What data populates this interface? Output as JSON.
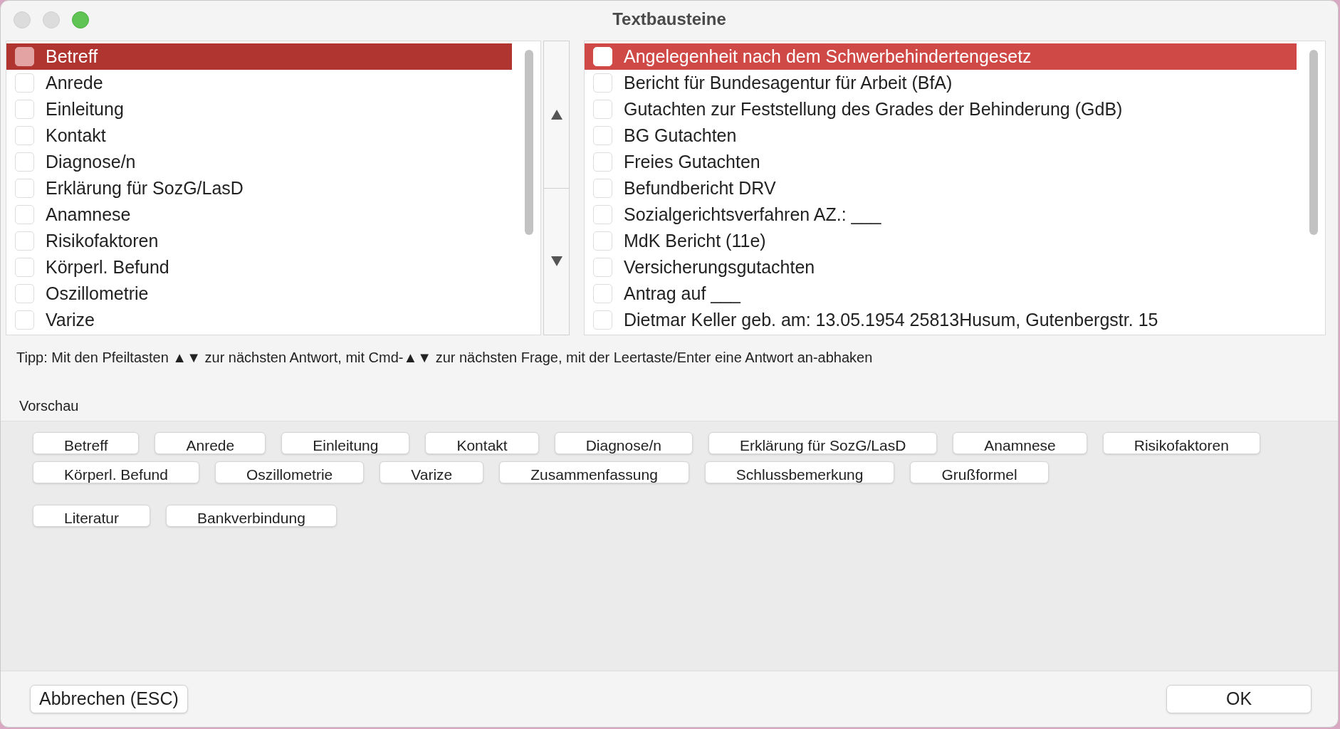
{
  "window": {
    "title": "Textbausteine"
  },
  "lists": [
    {
      "items": [
        {
          "label": "Betreff",
          "checked": false,
          "selected": true
        },
        {
          "label": "Anrede",
          "checked": false,
          "selected": false
        },
        {
          "label": "Einleitung",
          "checked": false,
          "selected": false
        },
        {
          "label": "Kontakt",
          "checked": false,
          "selected": false
        },
        {
          "label": "Diagnose/n",
          "checked": false,
          "selected": false
        },
        {
          "label": "Erklärung für SozG/LasD",
          "checked": false,
          "selected": false
        },
        {
          "label": "Anamnese",
          "checked": false,
          "selected": false
        },
        {
          "label": "Risikofaktoren",
          "checked": false,
          "selected": false
        },
        {
          "label": "Körperl. Befund",
          "checked": false,
          "selected": false
        },
        {
          "label": "Oszillometrie",
          "checked": false,
          "selected": false
        },
        {
          "label": "Varize",
          "checked": false,
          "selected": false
        }
      ]
    },
    {
      "items": [
        {
          "label": "Angelegenheit nach dem Schwerbehindertengesetz",
          "checked": false,
          "selected": true
        },
        {
          "label": "Bericht für Bundesagentur für Arbeit (BfA)",
          "checked": false,
          "selected": false
        },
        {
          "label": "Gutachten zur Feststellung des Grades der Behinderung (GdB)",
          "checked": false,
          "selected": false
        },
        {
          "label": "BG Gutachten",
          "checked": false,
          "selected": false
        },
        {
          "label": "Freies Gutachten",
          "checked": false,
          "selected": false
        },
        {
          "label": "Befundbericht DRV",
          "checked": false,
          "selected": false
        },
        {
          "label": "Sozialgerichtsverfahren AZ.: ___",
          "checked": false,
          "selected": false
        },
        {
          "label": "MdK Bericht (11e)",
          "checked": false,
          "selected": false
        },
        {
          "label": "Versicherungsgutachten",
          "checked": false,
          "selected": false
        },
        {
          "label": "Antrag auf ___",
          "checked": false,
          "selected": false
        },
        {
          "label": "Dietmar Keller geb. am: 13.05.1954 25813Husum, Gutenbergstr. 15",
          "checked": false,
          "selected": false
        }
      ]
    }
  ],
  "tip": "Tipp: Mit den Pfeiltasten ▲▼ zur nächsten Antwort, mit Cmd-▲▼  zur nächsten Frage, mit der Leertaste/Enter eine Antwort an-abhaken",
  "preview": {
    "label": "Vorschau",
    "groups": [
      {
        "buttons": [
          "Betreff",
          "Anrede",
          "Einleitung",
          "Kontakt",
          "Diagnose/n",
          "Erklärung für SozG/LasD",
          "Anamnese",
          "Risikofaktoren",
          "Körperl. Befund",
          "Oszillometrie",
          "Varize",
          "Zusammenfassung",
          "Schlussbemerkung",
          "Grußformel"
        ]
      },
      {
        "buttons": [
          "Literatur",
          "Bankverbindung"
        ]
      }
    ]
  },
  "buttons": {
    "cancel": "Abbrechen (ESC)",
    "ok": "OK"
  }
}
